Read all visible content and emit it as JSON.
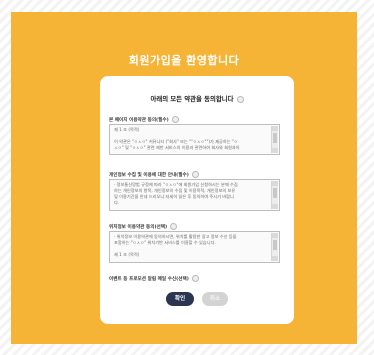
{
  "header": {
    "title": "회원가입을 환영합니다"
  },
  "agree_all": {
    "label": "아래의 모든 약관을 동의합니다"
  },
  "sections": [
    {
      "title": "본 페이지 이용약관 동의(필수)",
      "lines": [
        "제 1 조 (목적)",
        "",
        "이 약관은 \"ㅇㅅㅇ\" 커뮤니티 (\"회사\" 또는 \"\"ㅇㅅㅇ\"\")가 제공하는 \"ㅇ",
        "ㅅㅇ\" 및 \"ㅇㅅㅇ\" 관련 제반 서비스의 이용과 관련하여 회사와 회원과의"
      ]
    },
    {
      "title": "개인정보 수집 및 이용에 대한 안내(필수)",
      "lines": [
        "· 정보통신망법 규정에 따라 \"ㅇㅅㅇ\"에 회원가입 신청하시는 분께 수집",
        "하는 개인정보의 항목, 개인정보의 수집 및 이용목적, 개인정보의 보유",
        "및 이용기간을 안내 드리오니 자세히 읽은 후 동의하여 주시기 바랍니",
        "다."
      ]
    },
    {
      "title": "위치정보 이용약관 동의(선택)",
      "lines": [
        "· 위치정보 이용약관에 동의하시면, 위치를 활용한 광고 정보 수신 등을",
        "포함하는 \"ㅇㅅㅇ\" 위치기반 서비스를 이용할 수 있습니다.",
        "",
        "제 1 조 (목적)"
      ]
    }
  ],
  "marketing": {
    "label": "이벤트 등 프로모션 알림 메일 수신(선택)"
  },
  "buttons": {
    "confirm": "확인",
    "cancel": "취소"
  }
}
